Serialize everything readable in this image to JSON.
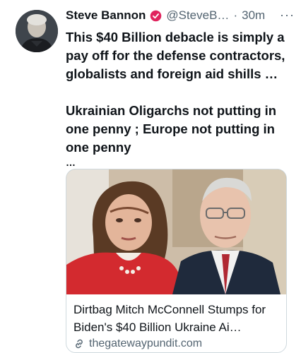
{
  "tweet": {
    "author_name": "Steve Bannon",
    "author_handle": "@SteveB…",
    "separator": "·",
    "time": "30m",
    "more_label": "···",
    "text_paragraph_1": "This $40 Billion debacle is simply a pay off for the defense contractors, globalists and foreign aid shills …",
    "text_paragraph_2": "Ukrainian Oligarchs not putting in one penny ; Europe not putting in one penny",
    "text_ellipsis": "…",
    "verified_badge_color": "#e0245e"
  },
  "card": {
    "title": "Dirtbag Mitch McConnell Stumps for Biden's $40 Billion Ukraine Ai…",
    "domain": "thegatewaypundit.com"
  },
  "icons": {
    "verified": "verified-badge-icon",
    "link": "link-icon",
    "more": "more-icon"
  }
}
